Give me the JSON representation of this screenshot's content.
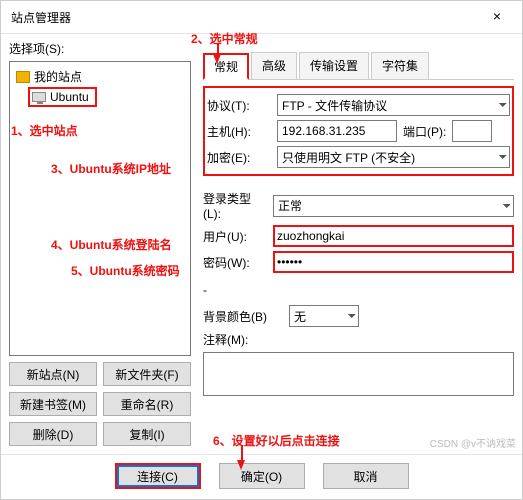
{
  "window": {
    "title": "站点管理器"
  },
  "left": {
    "select_label": "选择项(S):",
    "root_label": "我的站点",
    "child_label": "Ubuntu",
    "buttons": {
      "new_site": "新站点(N)",
      "new_folder": "新文件夹(F)",
      "new_bookmark": "新建书签(M)",
      "rename": "重命名(R)",
      "delete": "删除(D)",
      "copy": "复制(I)"
    }
  },
  "tabs": {
    "general": "常规",
    "advanced": "高级",
    "transfer": "传输设置",
    "charset": "字符集"
  },
  "form": {
    "protocol_label": "协议(T):",
    "protocol_value": "FTP - 文件传输协议",
    "host_label": "主机(H):",
    "host_value": "192.168.31.235",
    "port_label": "端口(P):",
    "port_value": "",
    "encryption_label": "加密(E):",
    "encryption_value": "只使用明文 FTP (不安全)",
    "logon_type_label": "登录类型(L):",
    "logon_type_value": "正常",
    "user_label": "用户(U):",
    "user_value": "zuozhongkai",
    "password_label": "密码(W):",
    "password_value": "••••••",
    "bgcolor_label": "背景颜色(B)",
    "bgcolor_value": "无",
    "comment_label": "注释(M):",
    "comment_value": ""
  },
  "bottom": {
    "connect": "连接(C)",
    "ok": "确定(O)",
    "cancel": "取消"
  },
  "annotations": {
    "a1": "1、选中站点",
    "a2": "2、选中常规",
    "a3": "3、Ubuntu系统IP地址",
    "a4": "4、Ubuntu系统登陆名",
    "a5": "5、Ubuntu系统密码",
    "a6": "6、设置好以后点击连接"
  },
  "watermark": "CSDN @v不讷戏菜"
}
